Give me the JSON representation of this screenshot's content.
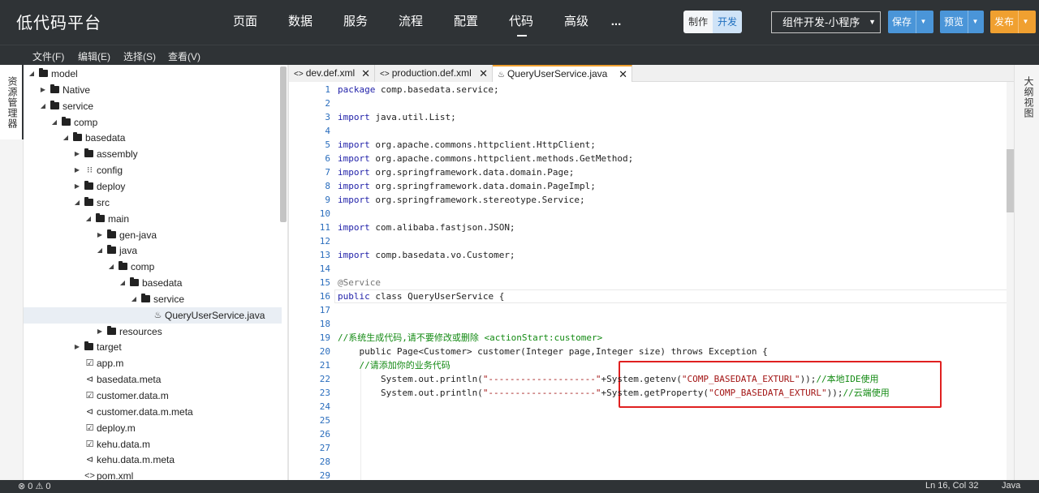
{
  "app": {
    "title": "低代码平台"
  },
  "nav": [
    {
      "label": "页面",
      "active": false
    },
    {
      "label": "数据",
      "active": false
    },
    {
      "label": "服务",
      "active": false
    },
    {
      "label": "流程",
      "active": false
    },
    {
      "label": "配置",
      "active": false
    },
    {
      "label": "代码",
      "active": true
    },
    {
      "label": "高级",
      "active": false
    }
  ],
  "nav_more": "...",
  "mode_toggle": {
    "make": "制作",
    "dev": "开发",
    "selected": "开发"
  },
  "env_select": {
    "value": "组件开发-小程序"
  },
  "actions": {
    "save": "保存",
    "preview": "预览",
    "publish": "发布"
  },
  "menu": [
    "文件(F)",
    "编辑(E)",
    "选择(S)",
    "查看(V)"
  ],
  "left_panel_tab": "资源管理器",
  "right_panel_tab": "大纲视图",
  "tree": [
    {
      "label": "model",
      "type": "folder",
      "expanded": true
    },
    {
      "label": "Native",
      "type": "folder",
      "expanded": false
    },
    {
      "label": "service",
      "type": "folder",
      "expanded": true
    },
    {
      "label": "comp",
      "type": "folder",
      "expanded": true
    },
    {
      "label": "basedata",
      "type": "folder",
      "expanded": true
    },
    {
      "label": "assembly",
      "type": "folder",
      "expanded": false
    },
    {
      "label": "config",
      "type": "config",
      "expanded": false
    },
    {
      "label": "deploy",
      "type": "folder",
      "expanded": false
    },
    {
      "label": "src",
      "type": "folder",
      "expanded": true
    },
    {
      "label": "main",
      "type": "folder",
      "expanded": true
    },
    {
      "label": "gen-java",
      "type": "folder",
      "expanded": false
    },
    {
      "label": "java",
      "type": "folder",
      "expanded": true
    },
    {
      "label": "comp",
      "type": "folder",
      "expanded": true
    },
    {
      "label": "basedata",
      "type": "folder",
      "expanded": true
    },
    {
      "label": "service",
      "type": "folder",
      "expanded": true
    },
    {
      "label": "QueryUserService.java",
      "type": "java",
      "selected": true
    },
    {
      "label": "resources",
      "type": "folder",
      "expanded": false
    },
    {
      "label": "target",
      "type": "folder",
      "expanded": false
    },
    {
      "label": "app.m",
      "type": "model"
    },
    {
      "label": "basedata.meta",
      "type": "meta"
    },
    {
      "label": "customer.data.m",
      "type": "model"
    },
    {
      "label": "customer.data.m.meta",
      "type": "meta"
    },
    {
      "label": "deploy.m",
      "type": "model"
    },
    {
      "label": "kehu.data.m",
      "type": "model"
    },
    {
      "label": "kehu.data.m.meta",
      "type": "meta"
    },
    {
      "label": "pom.xml",
      "type": "xml"
    }
  ],
  "tabs": [
    {
      "label": "dev.def.xml",
      "icon": "<>",
      "active": false
    },
    {
      "label": "production.def.xml",
      "icon": "<>",
      "active": false
    },
    {
      "label": "QueryUserService.java",
      "icon": "java",
      "active": true
    }
  ],
  "code_lines": [
    "package comp.basedata.service;",
    "",
    "import java.util.List;",
    "",
    "import org.apache.commons.httpclient.HttpClient;",
    "import org.apache.commons.httpclient.methods.GetMethod;",
    "import org.springframework.data.domain.Page;",
    "import org.springframework.data.domain.PageImpl;",
    "import org.springframework.stereotype.Service;",
    "",
    "import com.alibaba.fastjson.JSON;",
    "",
    "import comp.basedata.vo.Customer;",
    "",
    "@Service",
    "public class QueryUserService {",
    "",
    "",
    "//系统生成代码,请不要修改或删除 <actionStart:customer>",
    "    public Page<Customer> customer(Integer page,Integer size) throws Exception {",
    "    //请添加你的业务代码",
    "        System.out.println(\"--------------------\"+System.getenv(\"COMP_BASEDATA_EXTURL\"));//本地IDE使用",
    "        System.out.println(\"--------------------\"+System.getProperty(\"COMP_BASEDATA_EXTURL\"));//云端使用",
    "",
    "",
    "",
    "",
    "",
    ""
  ],
  "status": {
    "errors": "0",
    "warnings": "0",
    "position": "Ln 16, Col 32",
    "language": "Java"
  },
  "colors": {
    "topbar": "#2f3336",
    "accent_blue": "#4a95d8",
    "accent_orange": "#f0a030",
    "highlight_red": "#e02020"
  }
}
